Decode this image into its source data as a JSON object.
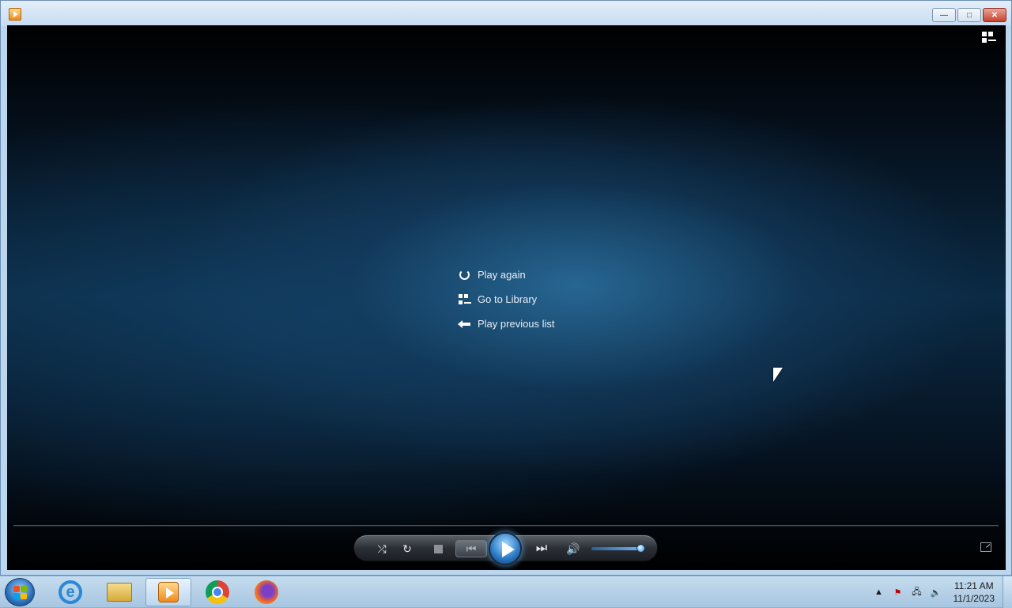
{
  "window": {
    "minimize_label": "—",
    "maximize_label": "□",
    "close_label": "✕"
  },
  "menu": {
    "items": [
      {
        "label": "Play again",
        "icon": "replay-icon"
      },
      {
        "label": "Go to Library",
        "icon": "library-icon"
      },
      {
        "label": "Play previous list",
        "icon": "back-arrow-icon"
      }
    ]
  },
  "controls": {
    "shuffle_glyph": "⤮",
    "repeat_glyph": "↻",
    "prev_glyph": "⏮",
    "next_glyph": "⏭",
    "mute_glyph": "🔊",
    "volume_level": 0.95
  },
  "taskbar": {
    "apps": [
      "internet-explorer-icon",
      "file-explorer-icon",
      "windows-media-player-icon",
      "chrome-icon",
      "firefox-icon"
    ],
    "active_app": "windows-media-player-icon",
    "tray": {
      "show_hidden_glyph": "▲",
      "flag_glyph": "⚑",
      "network_glyph": "🖧",
      "volume_glyph": "🔈"
    },
    "clock": {
      "time": "11:21 AM",
      "date": "11/1/2023"
    }
  },
  "colors": {
    "accent": "#2f7fc9",
    "background_glow": "#286996"
  }
}
